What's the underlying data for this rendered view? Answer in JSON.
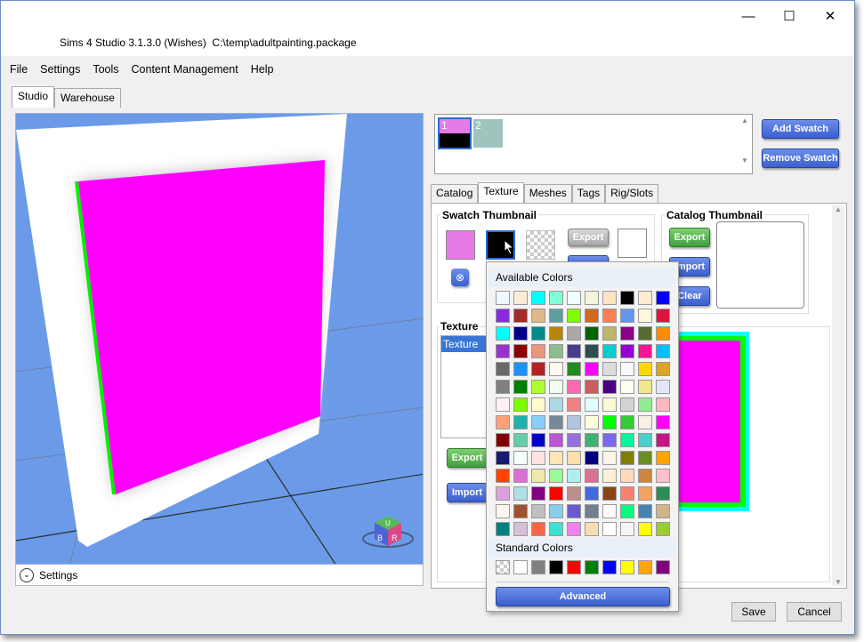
{
  "window": {
    "title": "Sims 4 Studio 3.1.3.0 (Wishes)  C:\\temp\\adultpainting.package",
    "minimize_glyph": "—",
    "maximize_glyph": "☐",
    "close_glyph": "✕"
  },
  "menu": [
    "File",
    "Settings",
    "Tools",
    "Content Management",
    "Help"
  ],
  "top_tabs": [
    "Studio",
    "Warehouse"
  ],
  "viewport": {
    "settings_label": "Settings",
    "gizmo": {
      "top": "U",
      "left": "B",
      "right": "R"
    }
  },
  "swatches": {
    "items": [
      {
        "number": "1",
        "top_color": "#e67ae6",
        "bottom_color": "#000000",
        "selected": true
      },
      {
        "number": "2",
        "color": "#9fc3bd",
        "selected": false
      }
    ],
    "add_label": "Add Swatch",
    "remove_label": "Remove Swatch"
  },
  "panel_tabs": [
    "Catalog",
    "Texture",
    "Meshes",
    "Tags",
    "Rig/Slots"
  ],
  "active_panel_tab": "Texture",
  "swatch_thumbnail": {
    "title": "Swatch Thumbnail",
    "color1": "#e67ae6",
    "color2": "#000000",
    "export_label": "Export"
  },
  "catalog_thumbnail": {
    "title": "Catalog Thumbnail",
    "export_label": "Export",
    "import_label": "Import",
    "clear_label": "Clear"
  },
  "texture": {
    "title": "Texture",
    "list_item": "Texture",
    "export_label": "Export",
    "import_label": "Import"
  },
  "color_popup": {
    "available_label": "Available Colors",
    "standard_label": "Standard Colors",
    "advanced_label": "Advanced",
    "available_colors": [
      "#f0f8ff",
      "#faebd7",
      "#00ffff",
      "#7fffd4",
      "#f0ffff",
      "#f5f5dc",
      "#ffe4c4",
      "#000000",
      "#ffebcd",
      "#0000ff",
      "#8a2be2",
      "#a52a2a",
      "#deb887",
      "#5f9ea0",
      "#7fff00",
      "#d2691e",
      "#ff7f50",
      "#6495ed",
      "#fff8dc",
      "#dc143c",
      "#00ffff",
      "#00008b",
      "#008b8b",
      "#b8860b",
      "#a9a9a9",
      "#006400",
      "#bdb76b",
      "#8b008b",
      "#556b2f",
      "#ff8c00",
      "#9932cc",
      "#8b0000",
      "#e9967a",
      "#8fbc8f",
      "#483d8b",
      "#2f4f4f",
      "#00ced1",
      "#9400d3",
      "#ff1493",
      "#00bfff",
      "#696969",
      "#1e90ff",
      "#b22222",
      "#fffaf0",
      "#228b22",
      "#ff00ff",
      "#dcdcdc",
      "#f8f8ff",
      "#ffd700",
      "#daa520",
      "#808080",
      "#008000",
      "#adff2f",
      "#f0fff0",
      "#ff69b4",
      "#cd5c5c",
      "#4b0082",
      "#fffff0",
      "#f0e68c",
      "#e6e6fa",
      "#fff0f5",
      "#7cfc00",
      "#fffacd",
      "#add8e6",
      "#f08080",
      "#e0ffff",
      "#fafad2",
      "#d3d3d3",
      "#90ee90",
      "#ffb6c1",
      "#ffa07a",
      "#20b2aa",
      "#87cefa",
      "#778899",
      "#b0c4de",
      "#ffffe0",
      "#00ff00",
      "#32cd32",
      "#faf0e6",
      "#ff00ff",
      "#800000",
      "#66cdaa",
      "#0000cd",
      "#ba55d3",
      "#9370db",
      "#3cb371",
      "#7b68ee",
      "#00fa9a",
      "#48d1cc",
      "#c71585",
      "#191970",
      "#f5fffa",
      "#ffe4e1",
      "#ffe4b5",
      "#ffdead",
      "#000080",
      "#fdf5e6",
      "#808000",
      "#6b8e23",
      "#ffa500",
      "#ff4500",
      "#da70d6",
      "#eee8aa",
      "#98fb98",
      "#afeeee",
      "#db7093",
      "#ffefd5",
      "#ffdab9",
      "#cd853f",
      "#ffc0cb",
      "#dda0dd",
      "#b0e0e6",
      "#800080",
      "#ff0000",
      "#bc8f8f",
      "#4169e1",
      "#8b4513",
      "#fa8072",
      "#f4a460",
      "#2e8b57",
      "#fff5ee",
      "#a0522d",
      "#c0c0c0",
      "#87ceeb",
      "#6a5acd",
      "#708090",
      "#fffafa",
      "#00ff7f",
      "#4682b4",
      "#d2b48c",
      "#008080",
      "#d8bfd8",
      "#ff6347",
      "#40e0d0",
      "#ee82ee",
      "#f5deb3",
      "#ffffff",
      "#f5f5f5",
      "#ffff00",
      "#9acd32"
    ],
    "standard_colors": [
      "transparent",
      "#ffffff",
      "#808080",
      "#000000",
      "#ff0000",
      "#008000",
      "#0000ff",
      "#ffff00",
      "#ffa500",
      "#800080"
    ]
  },
  "footer": {
    "save_label": "Save",
    "cancel_label": "Cancel"
  },
  "colors": {
    "painting_magenta": "#ff00ff",
    "painting_edge": "#00ff00",
    "viewport_bg": "#6b9be8"
  }
}
